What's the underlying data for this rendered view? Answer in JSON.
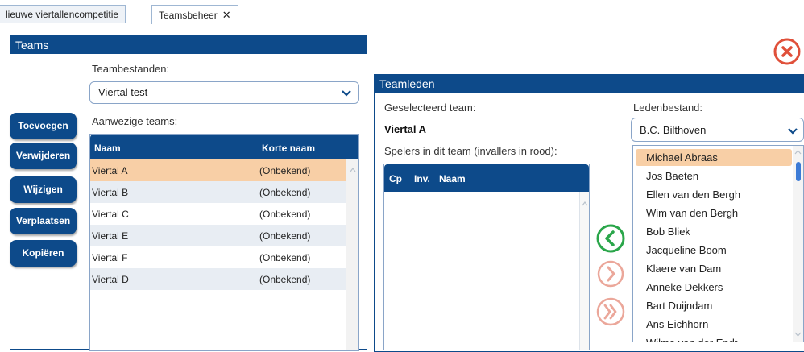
{
  "tabs": [
    {
      "label": "lieuwe viertallencompetitie"
    },
    {
      "label": "Teamsbeheer",
      "close": "✕"
    }
  ],
  "teams_panel": {
    "title": "Teams",
    "bestanden_label": "Teambestanden:",
    "bestanden_value": "Viertal test",
    "aanwezig_label": "Aanwezige teams:",
    "buttons": [
      "Toevoegen",
      "Verwijderen",
      "Wijzigen",
      "Verplaatsen",
      "Kopiëren"
    ],
    "columns": [
      "Naam",
      "Korte naam"
    ],
    "rows": [
      {
        "naam": "Viertal A",
        "korte": "(Onbekend)"
      },
      {
        "naam": "Viertal B",
        "korte": "(Onbekend)"
      },
      {
        "naam": "Viertal C",
        "korte": "(Onbekend)"
      },
      {
        "naam": "Viertal E",
        "korte": "(Onbekend)"
      },
      {
        "naam": "Viertal F",
        "korte": "(Onbekend)"
      },
      {
        "naam": "Viertal D",
        "korte": "(Onbekend)"
      }
    ]
  },
  "teamleden_panel": {
    "title": "Teamleden",
    "geselecteerd_label": "Geselecteerd team:",
    "geselecteerd_value": "Viertal A",
    "spelers_label": "Spelers in dit team (invallers in rood):",
    "columns": [
      "Cp",
      "Inv.",
      "Naam"
    ],
    "ledenbestand_label": "Ledenbestand:",
    "ledenbestand_value": "B.C. Bilthoven",
    "members": [
      "Michael Abraas",
      "Jos Baeten",
      "Ellen van den Bergh",
      "Wim van den Bergh",
      "Bob Bliek",
      "Jacqueline Boom",
      "Klaere van Dam",
      "Anneke Dekkers",
      "Bart Duijndam",
      "Ans Eichhorn",
      "Wilma van der Endt"
    ]
  },
  "colors": {
    "header_blue": "#0d4a8a",
    "selection": "#f8cfa6",
    "close_red": "#e0503a",
    "arrow_green": "#2aa64a",
    "arrow_disabled": "#eba79a"
  }
}
